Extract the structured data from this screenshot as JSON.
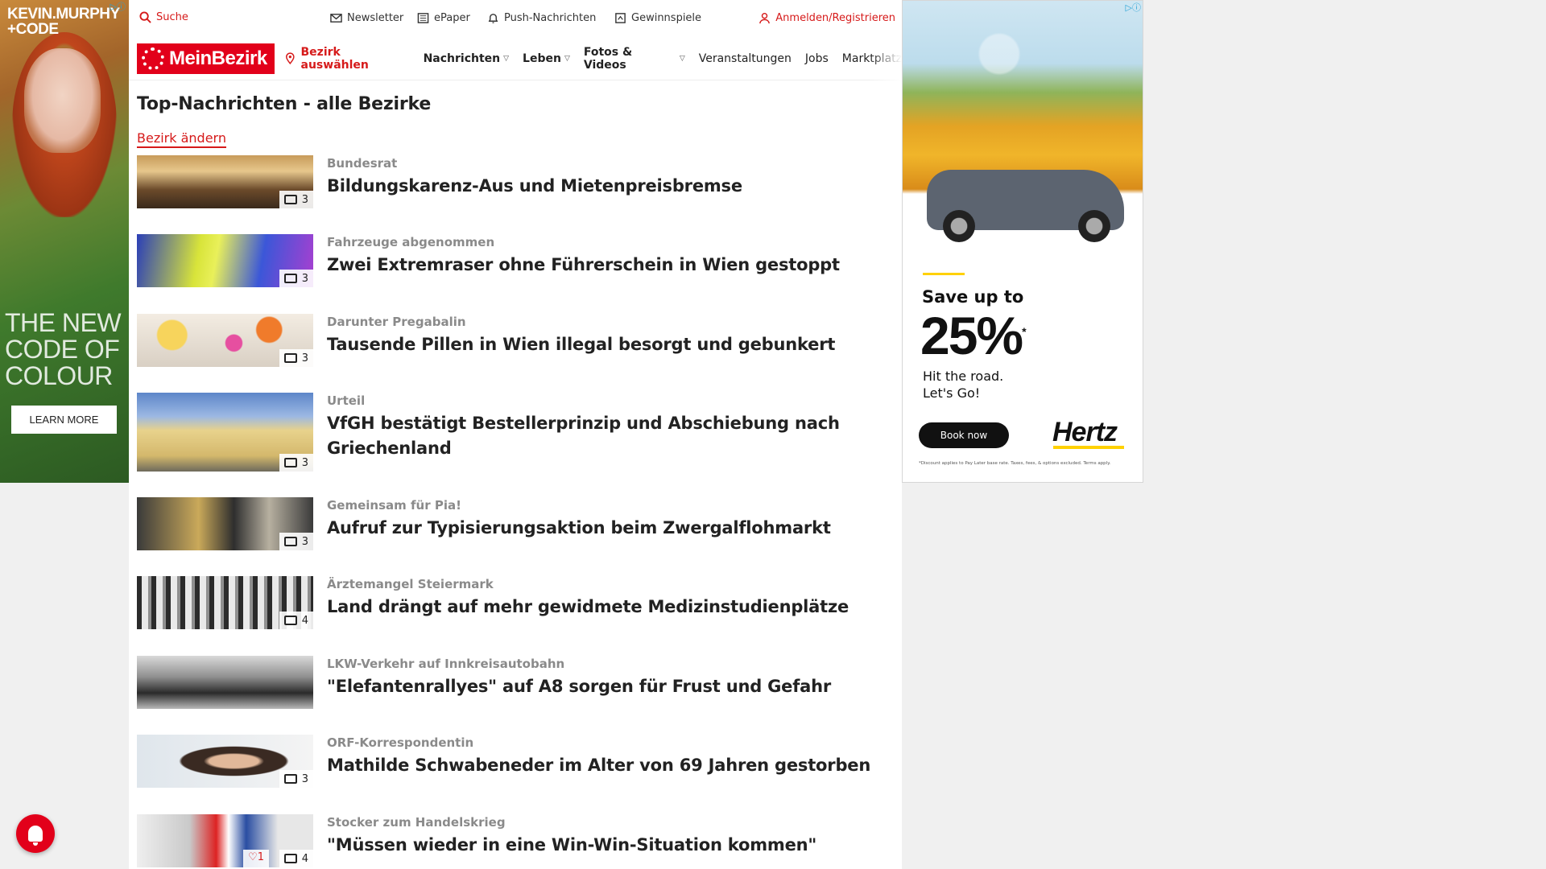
{
  "ad_left": {
    "brand": "KEVIN.MURPHY\n+CODE",
    "slogan": "THE NEW\nCODE OF\nCOLOUR",
    "cta": "LEARN MORE",
    "adchoices": "▷ⓘ"
  },
  "topbar": {
    "search": "Suche",
    "newsletter": "Newsletter",
    "epaper": "ePaper",
    "push": "Push-Nachrichten",
    "gewinnspiele": "Gewinnspiele",
    "login": "Anmelden/Registrieren"
  },
  "navbar": {
    "logo": "MeinBezirk",
    "bezirk": "Bezirk auswählen",
    "items": [
      {
        "label": "Nachrichten",
        "dropdown": true
      },
      {
        "label": "Leben",
        "dropdown": true
      },
      {
        "label": "Fotos & Videos",
        "dropdown": true
      },
      {
        "label": "Veranstaltungen",
        "dropdown": false
      },
      {
        "label": "Jobs",
        "dropdown": false
      },
      {
        "label": "Marktplatz",
        "dropdown": false
      }
    ]
  },
  "page": {
    "title": "Top-Nachrichten - alle Bezirke",
    "change_link": "Bezirk ändern"
  },
  "articles": [
    {
      "kicker": "Bundesrat",
      "headline": "Bildungskarenz-Aus und Mietenpreisbremse",
      "photos": "3",
      "likes": ""
    },
    {
      "kicker": "Fahrzeuge abgenommen",
      "headline": "Zwei Extremraser ohne Führerschein in Wien gestoppt",
      "photos": "3",
      "likes": ""
    },
    {
      "kicker": "Darunter Pregabalin",
      "headline": "Tausende Pillen in Wien illegal besorgt und gebunkert",
      "photos": "3",
      "likes": ""
    },
    {
      "kicker": "Urteil",
      "headline": "VfGH bestätigt Bestellerprinzip und Abschiebung nach Griechenland",
      "photos": "3",
      "likes": ""
    },
    {
      "kicker": "Gemeinsam für Pia!",
      "headline": "Aufruf zur Typisierungsaktion beim Zwergalflohmarkt",
      "photos": "3",
      "likes": ""
    },
    {
      "kicker": "Ärztemangel Steiermark",
      "headline": "Land drängt auf mehr gewidmete Medizinstudienplätze",
      "photos": "4",
      "likes": ""
    },
    {
      "kicker": "LKW-Verkehr auf Innkreisautobahn",
      "headline": "\"Elefantenrallyes\" auf A8 sorgen für Frust und Gefahr",
      "photos": "",
      "likes": ""
    },
    {
      "kicker": "ORF-Korrespondentin",
      "headline": "Mathilde Schwabeneder im Alter von 69 Jahren gestorben",
      "photos": "3",
      "likes": ""
    },
    {
      "kicker": "Stocker zum Handelskrieg",
      "headline": "\"Müssen wieder in eine Win-Win-Situation kommen\"",
      "photos": "4",
      "likes": "♡1"
    }
  ],
  "ad_right": {
    "save": "Save up to",
    "percent": "25%",
    "percent_mark": "*",
    "line1": "Hit the road.",
    "line2": "Let's Go!",
    "cta": "Book now",
    "brand": "Hertz",
    "fine": "*Discount applies to Pay Later base rate. Taxes, fees, & options excluded. Terms apply.",
    "adchoices": "▷ⓘ"
  },
  "colors": {
    "brand_red": "#e2001a",
    "text": "#222222",
    "kicker_gray": "#8a8a8a"
  }
}
